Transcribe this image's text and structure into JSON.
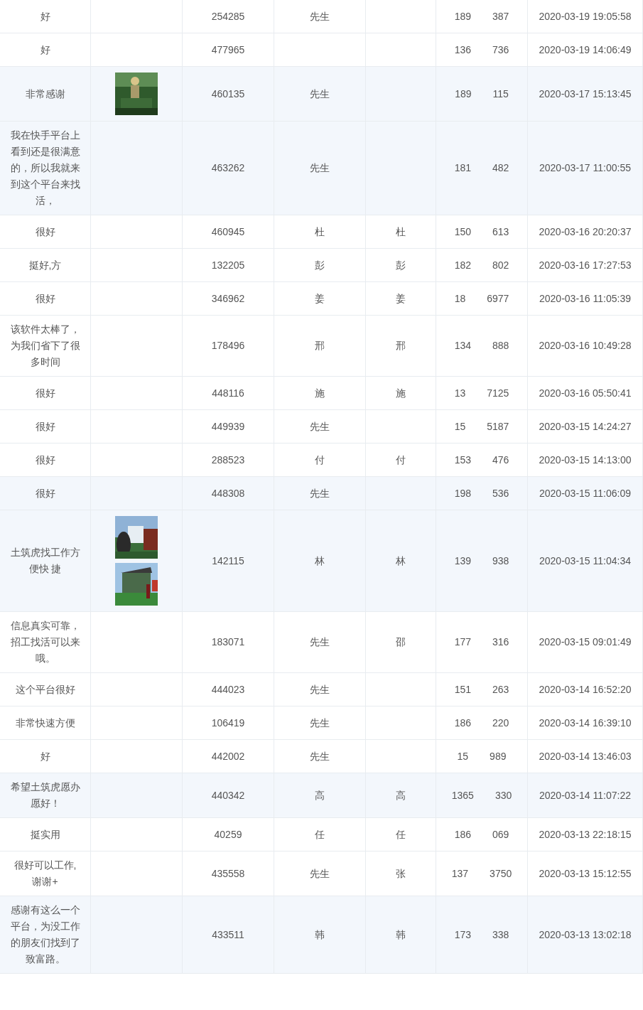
{
  "rows": [
    {
      "comment": "好",
      "highlighted": false,
      "images": [],
      "id": "254285",
      "title": "先生",
      "name": "",
      "phone_start": "189",
      "phone_end": "387",
      "time": "2020-03-19 19:05:58"
    },
    {
      "comment": "好",
      "highlighted": false,
      "images": [],
      "id": "477965",
      "title": "",
      "name": "",
      "phone_start": "136",
      "phone_end": "736",
      "time": "2020-03-19 14:06:49"
    },
    {
      "comment": "非常感谢",
      "highlighted": true,
      "id": "460135",
      "title": "先生",
      "name": "",
      "phone_start": "189",
      "phone_end": "115",
      "time": "2020-03-17 15:13:45"
    },
    {
      "comment": "我在快手平台上看到还是很满意的，所以我就来到这个平台来找活，",
      "highlighted": true,
      "images": [],
      "id": "463262",
      "title": "先生",
      "name": "",
      "phone_start": "181",
      "phone_end": "482",
      "time": "2020-03-17 11:00:55"
    },
    {
      "comment": "很好",
      "highlighted": false,
      "images": [],
      "id": "460945",
      "title": "杜",
      "name": "杜",
      "phone_start": "150",
      "phone_end": "613",
      "time": "2020-03-16 20:20:37"
    },
    {
      "comment": "挺好,方",
      "highlighted": false,
      "images": [],
      "id": "132205",
      "title": "彭",
      "name": "彭",
      "phone_start": "182",
      "phone_end": "802",
      "time": "2020-03-16 17:27:53"
    },
    {
      "comment": "很好",
      "highlighted": false,
      "images": [],
      "id": "346962",
      "title": "姜",
      "name": "姜",
      "phone_start": "18",
      "phone_end": "6977",
      "time": "2020-03-16 11:05:39"
    },
    {
      "comment": "该软件太棒了，为我们省下了很多时间",
      "highlighted": false,
      "images": [],
      "id": "178496",
      "title": "邢",
      "name": "邢",
      "phone_start": "134",
      "phone_end": "888",
      "time": "2020-03-16 10:49:28"
    },
    {
      "comment": "很好",
      "highlighted": false,
      "images": [],
      "id": "448116",
      "title": "施",
      "name": "施",
      "phone_start": "13",
      "phone_end": "7125",
      "time": "2020-03-16 05:50:41"
    },
    {
      "comment": "很好",
      "highlighted": false,
      "images": [],
      "id": "449939",
      "title": "先生",
      "name": "",
      "phone_start": "15",
      "phone_end": "5187",
      "time": "2020-03-15 14:24:27"
    },
    {
      "comment": "很好",
      "highlighted": false,
      "images": [],
      "id": "288523",
      "title": "付",
      "name": "付",
      "phone_start": "153",
      "phone_end": "476",
      "time": "2020-03-15 14:13:00"
    },
    {
      "comment": "很好",
      "highlighted": true,
      "images": [],
      "id": "448308",
      "title": "先生",
      "name": "",
      "phone_start": "198",
      "phone_end": "536",
      "time": "2020-03-15 11:06:09"
    },
    {
      "comment": "土筑虎找工作方便快 捷",
      "highlighted": true,
      "id": "142115",
      "title": "林",
      "name": "林",
      "phone_start": "139",
      "phone_end": "938",
      "time": "2020-03-15 11:04:34"
    },
    {
      "comment": "信息真实可靠，招工找活可以来哦。",
      "highlighted": false,
      "images": [],
      "id": "183071",
      "title": "先生",
      "name": "邵",
      "phone_start": "177",
      "phone_end": "316",
      "time": "2020-03-15 09:01:49"
    },
    {
      "comment": "这个平台很好",
      "highlighted": false,
      "images": [],
      "id": "444023",
      "title": "先生",
      "name": "",
      "phone_start": "151",
      "phone_end": "263",
      "time": "2020-03-14 16:52:20"
    },
    {
      "comment": "非常快速方便",
      "highlighted": false,
      "images": [],
      "id": "106419",
      "title": "先生",
      "name": "",
      "phone_start": "186",
      "phone_end": "220",
      "time": "2020-03-14 16:39:10"
    },
    {
      "comment": "好",
      "highlighted": false,
      "images": [],
      "id": "442002",
      "title": "先生",
      "name": "",
      "phone_start": "15",
      "phone_end": "989",
      "time": "2020-03-14 13:46:03"
    },
    {
      "comment": "希望土筑虎愿办愿好！",
      "highlighted": true,
      "images": [],
      "id": "440342",
      "title": "高",
      "name": "高",
      "phone_start": "1365",
      "phone_end": "330",
      "time": "2020-03-14 11:07:22"
    },
    {
      "comment": "挺实用",
      "highlighted": false,
      "images": [],
      "id": "40259",
      "title": "任",
      "name": "任",
      "phone_start": "186",
      "phone_end": "069",
      "time": "2020-03-13 22:18:15"
    },
    {
      "comment": "很好可以工作,谢谢+",
      "highlighted": false,
      "images": [],
      "id": "435558",
      "title": "先生",
      "name": "张",
      "phone_start": "137",
      "phone_end": "3750",
      "time": "2020-03-13 15:12:55"
    },
    {
      "comment": "感谢有这么一个平台，为没工作的朋友们找到了致富路。",
      "highlighted": true,
      "images": [],
      "id": "433511",
      "title": "韩",
      "name": "韩",
      "phone_start": "173",
      "phone_end": "338",
      "time": "2020-03-13 13:02:18"
    }
  ]
}
